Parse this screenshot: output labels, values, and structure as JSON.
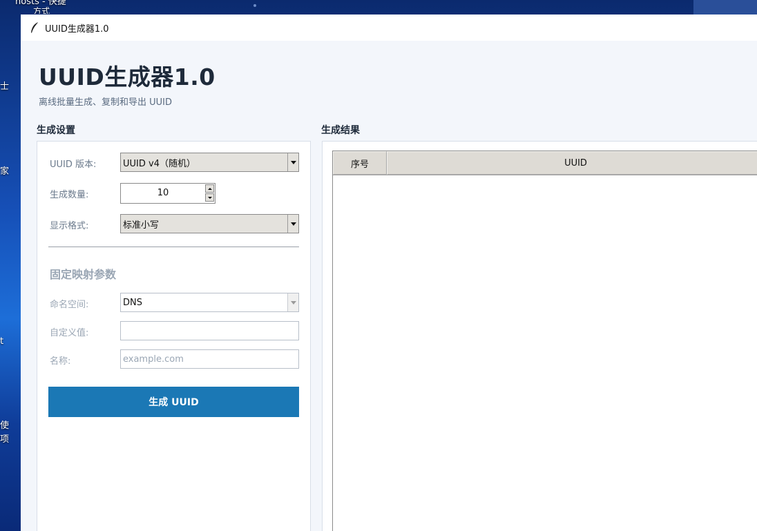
{
  "desktop": {
    "top_text": "hosts - 快捷",
    "top_text2": "方式",
    "fragments": [
      {
        "text": "士"
      },
      {
        "text": "家"
      },
      {
        "text": "t"
      },
      {
        "text": "使"
      },
      {
        "text": "项"
      }
    ]
  },
  "window": {
    "title": "UUID生成器1.0",
    "icon": "feather-icon"
  },
  "header": {
    "title": "UUID生成器1.0",
    "subtitle": "离线批量生成、复制和导出 UUID"
  },
  "settings": {
    "section_label": "生成设置",
    "version_label": "UUID 版本:",
    "version_value": "UUID v4（随机）",
    "count_label": "生成数量:",
    "count_value": "10",
    "format_label": "显示格式:",
    "format_value": "标准小写",
    "fixed_heading": "固定映射参数",
    "namespace_label": "命名空间:",
    "namespace_value": "DNS",
    "custom_label": "自定义值:",
    "custom_value": "",
    "name_label": "名称:",
    "name_placeholder": "example.com",
    "generate_button": "生成 UUID"
  },
  "results": {
    "section_label": "生成结果",
    "columns": [
      "序号",
      "UUID"
    ],
    "rows": []
  },
  "colors": {
    "accent": "#1b78b5",
    "window_bg": "#f3f6fb",
    "title_text": "#1e2a3a"
  }
}
